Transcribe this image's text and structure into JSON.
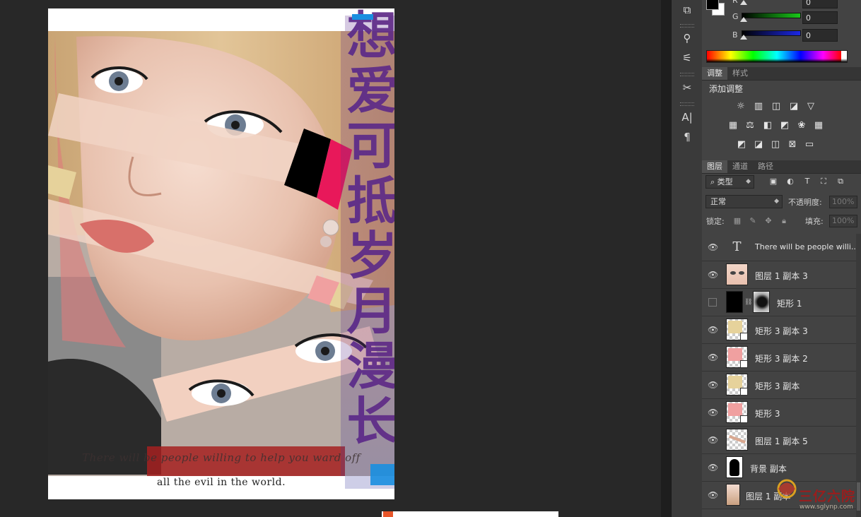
{
  "canvas": {
    "caption_line1": "There will be people willing to help you ward off",
    "caption_line2": "all the evil in the world.",
    "vertical_title": "想爱可抵岁月漫长"
  },
  "color_panel": {
    "sliders": [
      {
        "label": "R",
        "value": "0",
        "color": "#e03030"
      },
      {
        "label": "G",
        "value": "0",
        "color": "#30c030"
      },
      {
        "label": "B",
        "value": "0",
        "color": "#2030e0"
      }
    ],
    "foreground": "#000000",
    "background": "#ffffff"
  },
  "adjustments": {
    "tabs": [
      "调整",
      "样式"
    ],
    "title": "添加调整",
    "icons_row1": [
      "brightness-icon",
      "levels-icon",
      "curves-icon",
      "exposure-icon",
      "vibrance-icon"
    ],
    "icons_row2": [
      "hue-saturation-icon",
      "color-balance-icon",
      "black-white-icon",
      "photo-filter-icon",
      "channel-mixer-icon",
      "color-lookup-icon"
    ],
    "icons_row3": [
      "invert-icon",
      "posterize-icon",
      "threshold-icon",
      "selective-color-icon",
      "gradient-map-icon"
    ]
  },
  "layers_panel": {
    "tabs": [
      "图层",
      "通道",
      "路径"
    ],
    "filter_kind": "类型",
    "blend_mode": "正常",
    "opacity_label": "不透明度:",
    "opacity_value": "100%",
    "lock_label": "锁定:",
    "fill_label": "填充:",
    "fill_value": "100%",
    "layers": [
      {
        "name": "There will be people willi...",
        "type": "text",
        "visible": true
      },
      {
        "name": "图层 1 副本 3",
        "type": "image-eyes",
        "visible": true
      },
      {
        "name": "矩形 1",
        "type": "mask",
        "visible": false
      },
      {
        "name": "矩形 3 副本 3",
        "type": "shape",
        "color": "#e6d29b",
        "visible": true
      },
      {
        "name": "矩形 3 副本 2",
        "type": "shape",
        "color": "#f0a0a0",
        "visible": true
      },
      {
        "name": "矩形 3 副本",
        "type": "shape",
        "color": "#e6d29b",
        "visible": true
      },
      {
        "name": "矩形 3",
        "type": "shape",
        "color": "#f0a0a0",
        "visible": true
      },
      {
        "name": "图层 1 副本 5",
        "type": "image-strip",
        "visible": true
      },
      {
        "name": "背景 副本",
        "type": "silhouette",
        "visible": true
      },
      {
        "name": "图层 1 副本",
        "type": "image",
        "visible": true
      }
    ]
  },
  "watermark": {
    "text": "三亿六院",
    "url": "www.sglynp.com"
  }
}
